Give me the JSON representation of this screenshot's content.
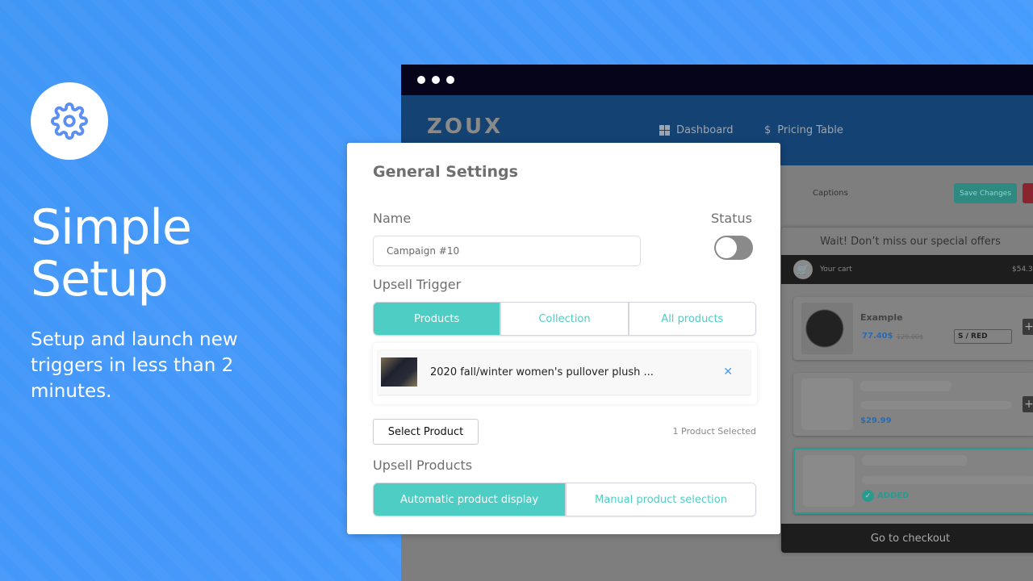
{
  "hero": {
    "icon": "gear-icon",
    "title_line1": "Simple",
    "title_line2": "Setup",
    "subtitle": "Setup and launch new triggers in less than 2 minutes."
  },
  "app": {
    "logo": "ZOUX",
    "nav": [
      {
        "icon": "dashboard-icon",
        "label": "Dashboard"
      },
      {
        "icon": "dollar-icon",
        "label": "Pricing Table"
      }
    ],
    "captions_tab": "Captions",
    "save_label": "Save Changes"
  },
  "cart": {
    "header": "Wait! Don’t miss our special offers",
    "title": "Your cart",
    "total": "$54.3",
    "items": [
      {
        "name": "Example",
        "price": "77.40$",
        "old_price": "129.00$",
        "variant": "S / RED"
      },
      {
        "price": "$29.99"
      },
      {
        "status": "ADDED"
      }
    ],
    "checkout_label": "Go to checkout"
  },
  "settings": {
    "title": "General Settings",
    "name_label": "Name",
    "name_value": "Campaign #10",
    "status_label": "Status",
    "status_on": false,
    "trigger_label": "Upsell Trigger",
    "trigger_options": [
      "Products",
      "Collection",
      "All products"
    ],
    "trigger_selected": "Products",
    "selected_product": "2020 fall/winter women's pullover plush ...",
    "select_button": "Select Product",
    "selected_count": "1 Product Selected",
    "upsell_label": "Upsell Products",
    "upsell_options": [
      "Automatic product display",
      "Manual product selection"
    ],
    "upsell_selected": "Automatic product display"
  },
  "colors": {
    "accent": "#4ecdc4",
    "background": "#4698fb",
    "header": "#134273"
  }
}
